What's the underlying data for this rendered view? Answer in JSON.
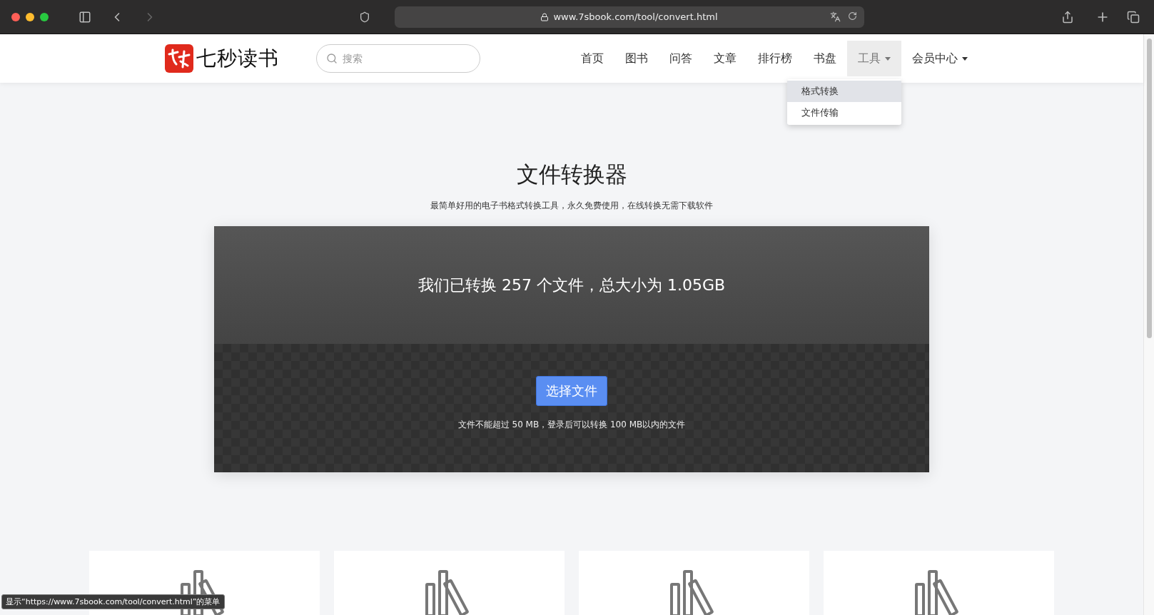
{
  "browser": {
    "url": "www.7sbook.com/tool/convert.html"
  },
  "header": {
    "logo_text": "七秒读书",
    "search": {
      "placeholder": "搜索"
    },
    "nav": [
      {
        "label": "首页",
        "selected": false,
        "dropdown": false
      },
      {
        "label": "图书",
        "selected": false,
        "dropdown": false
      },
      {
        "label": "问答",
        "selected": false,
        "dropdown": false
      },
      {
        "label": "文章",
        "selected": false,
        "dropdown": false
      },
      {
        "label": "排行榜",
        "selected": false,
        "dropdown": false
      },
      {
        "label": "书盘",
        "selected": false,
        "dropdown": false
      },
      {
        "label": "工具",
        "selected": true,
        "dropdown": true,
        "menu": [
          {
            "label": "格式转换",
            "selected": true
          },
          {
            "label": "文件传输",
            "selected": false
          }
        ]
      },
      {
        "label": "会员中心",
        "selected": false,
        "dropdown": true
      }
    ]
  },
  "hero": {
    "title": "文件转换器",
    "subtitle": "最简单好用的电子书格式转换工具，永久免费使用，在线转换无需下载软件"
  },
  "converter": {
    "stats": "我们已转换 257 个文件，总大小为 1.05GB",
    "button": "选择文件",
    "note": "文件不能超过 50 MB，登录后可以转换 100 MB以内的文件"
  },
  "cards": [
    {
      "kind": "books"
    },
    {
      "kind": "books"
    },
    {
      "kind": "books"
    },
    {
      "kind": "books"
    }
  ],
  "status_bar": {
    "text": "显示“https://www.7sbook.com/tool/convert.html”的菜单"
  }
}
